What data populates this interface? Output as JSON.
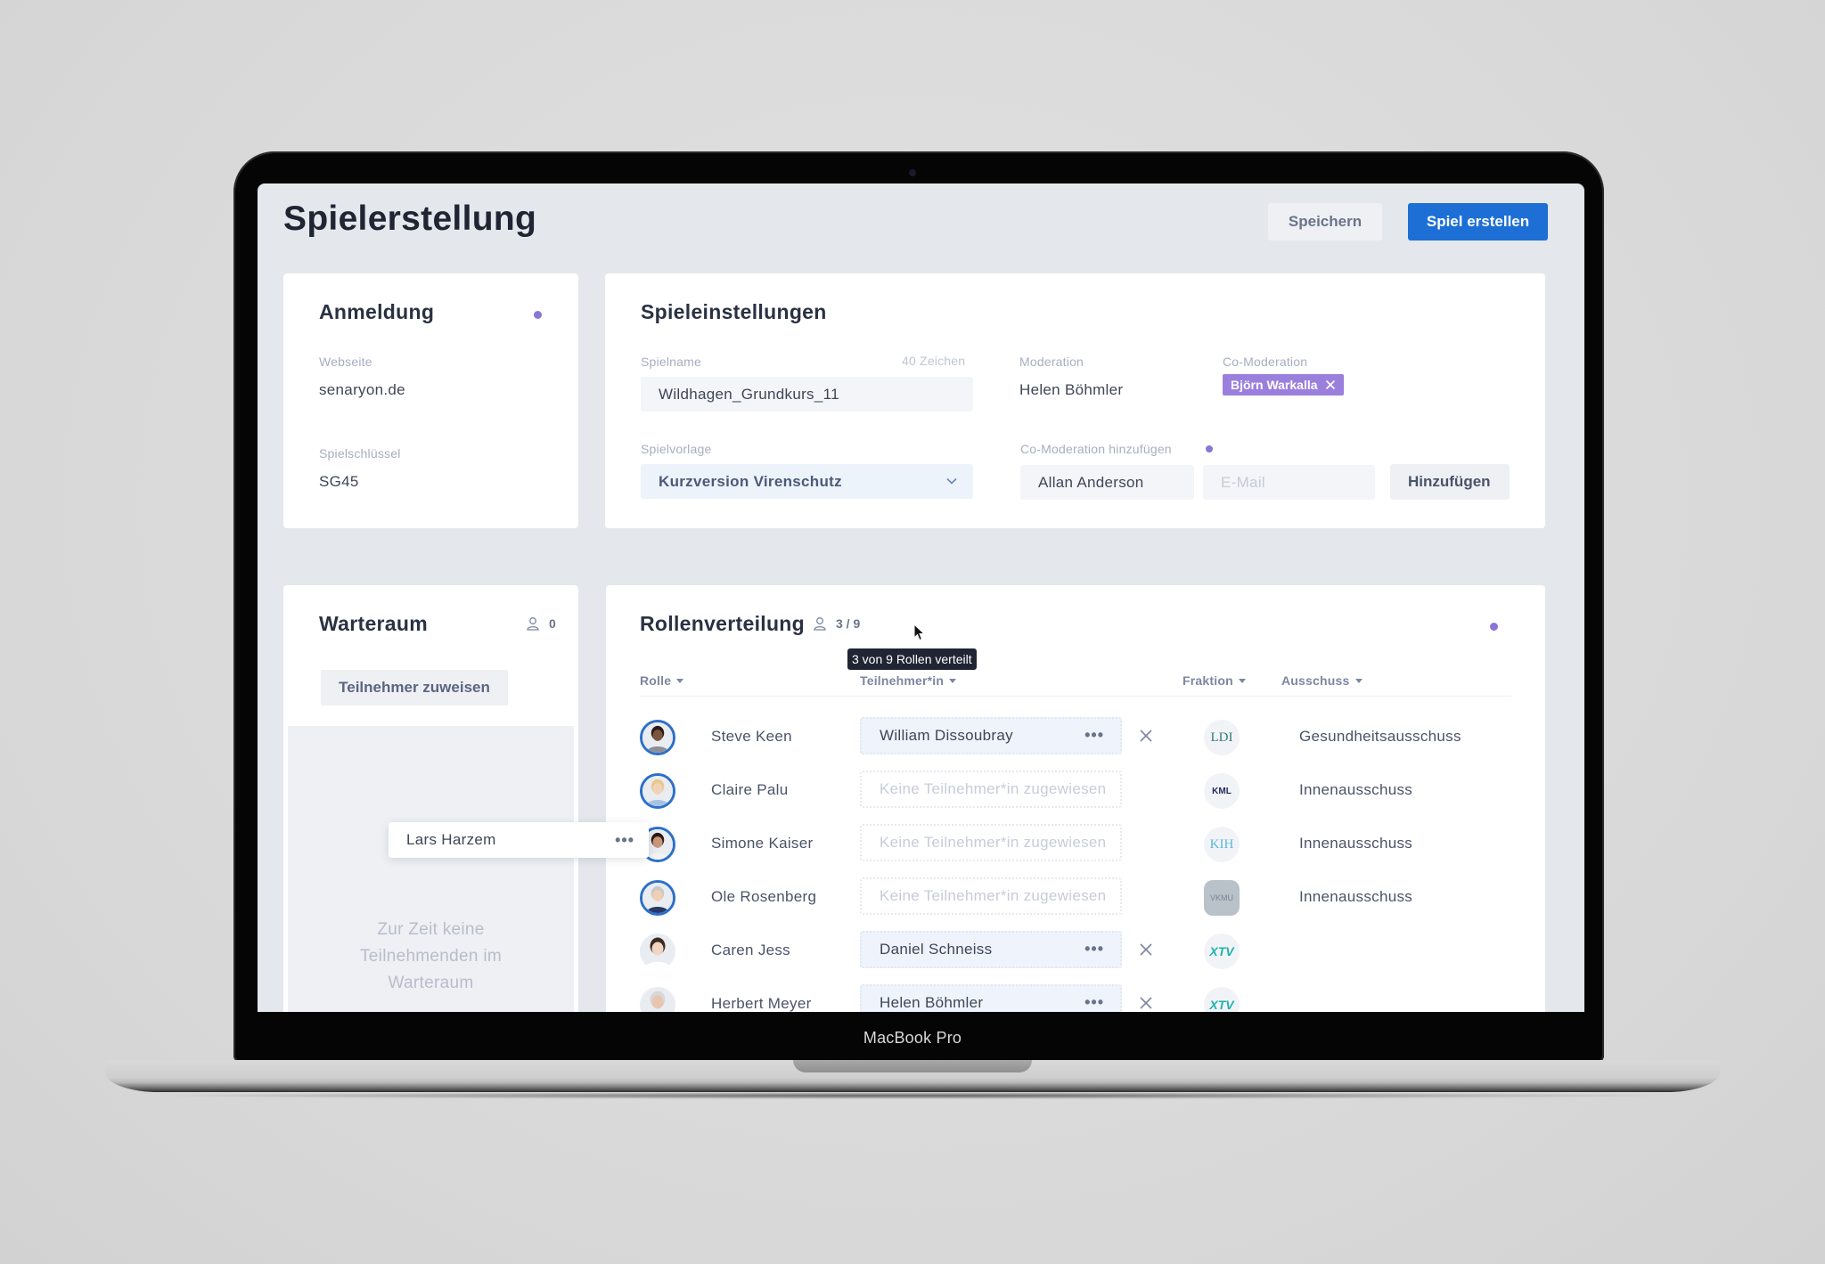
{
  "device": {
    "label": "MacBook Pro"
  },
  "header": {
    "title": "Spielerstellung",
    "save_label": "Speichern",
    "create_label": "Spiel erstellen"
  },
  "colors": {
    "accent": "#1d6fd6",
    "status_dot": "#8a75d9",
    "chip": "#9b7fdd"
  },
  "anmeldung": {
    "title": "Anmeldung",
    "website_label": "Webseite",
    "website_value": "senaryon.de",
    "key_label": "Spielschlüssel",
    "key_value": "SG45"
  },
  "settings": {
    "title": "Spieleinstellungen",
    "name_label": "Spielname",
    "name_limit": "40 Zeichen",
    "name_value": "Wildhagen_Grundkurs_11",
    "template_label": "Spielvorlage",
    "template_value": "Kurzversion Virenschutz",
    "moderation_label": "Moderation",
    "moderation_value": "Helen Böhmler",
    "comod_label": "Co-Moderation",
    "comod_chip": "Björn Warkalla",
    "add_comod_label": "Co-Moderation hinzufügen",
    "add_name_value": "Allan Anderson",
    "add_email_placeholder": "E-Mail",
    "add_button": "Hinzufügen"
  },
  "warteraum": {
    "title": "Warteraum",
    "count": "0",
    "assign_button": "Teilnehmer zuweisen",
    "empty_message": "Zur Zeit keine Teilnehmenden im Warteraum",
    "dragged_participant": "Lars Harzem"
  },
  "rollen": {
    "title": "Rollenverteilung",
    "count": "3 / 9",
    "tooltip": "3 von 9 Rollen verteilt",
    "columns": [
      "Rolle",
      "Teilnehmer*in",
      "Fraktion",
      "Ausschuss"
    ],
    "empty_slot": "Keine Teilnehmer*in zugewiesen",
    "rows": [
      {
        "role": "Steve Keen",
        "participant": "William Dissoubray",
        "party": "LDI",
        "committee": "Gesundheitsausschuss"
      },
      {
        "role": "Claire Palu",
        "participant": "",
        "party": "KML",
        "committee": "Innenausschuss"
      },
      {
        "role": "Simone Kaiser",
        "participant": "",
        "party": "KIH",
        "committee": "Innenausschuss"
      },
      {
        "role": "Ole Rosenberg",
        "participant": "",
        "party": "VKMU",
        "committee": "Innenausschuss"
      },
      {
        "role": "Caren Jess",
        "participant": "Daniel Schneiss",
        "party": "XTV",
        "committee": ""
      },
      {
        "role": "Herbert Meyer",
        "participant": "Helen Böhmler",
        "party": "XTV",
        "committee": ""
      }
    ]
  }
}
